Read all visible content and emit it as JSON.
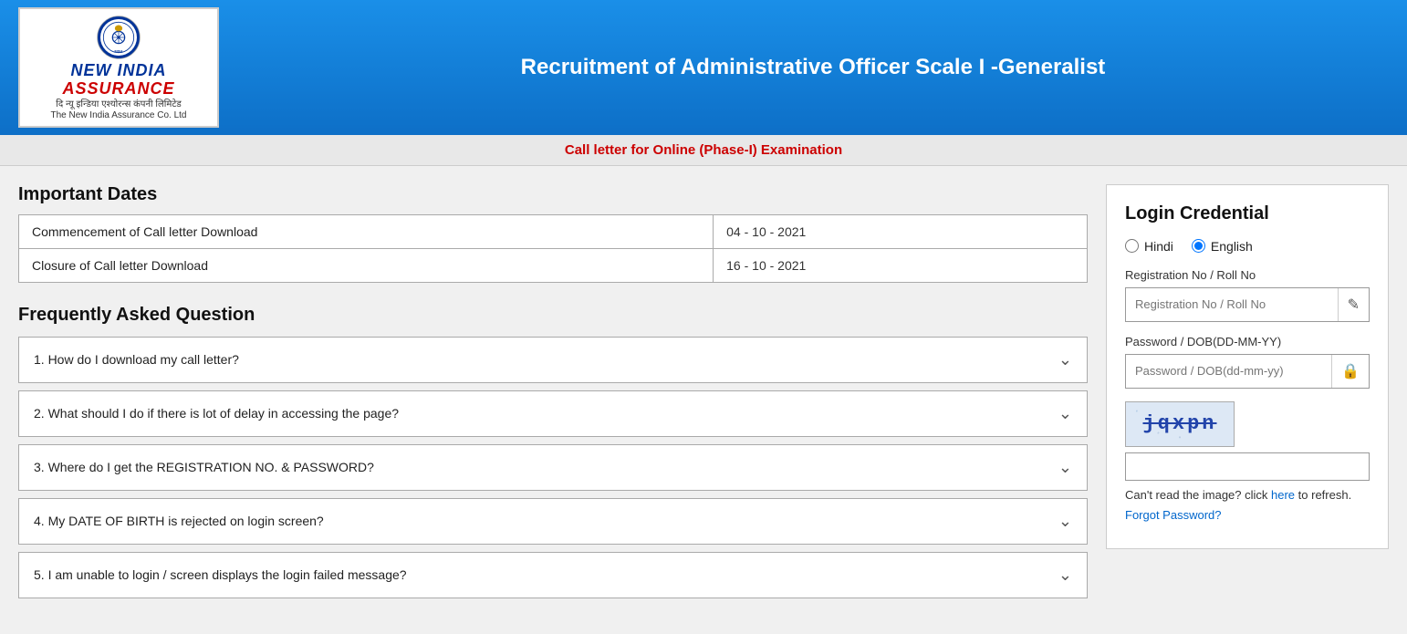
{
  "header": {
    "logo": {
      "title_line1": "NEW INDIA",
      "title_line2": "ASSURANCE",
      "hindi_line1": "दि न्यू इन्डिया एश्योरन्स कंपनी लिमिटेड",
      "english_line": "The New India Assurance Co. Ltd"
    },
    "title": "Recruitment of Administrative Officer Scale I -Generalist"
  },
  "sub_header": {
    "text": "Call letter for Online (Phase-I) Examination"
  },
  "important_dates": {
    "section_title": "Important Dates",
    "rows": [
      {
        "label": "Commencement of Call letter Download",
        "date": "04 - 10 - 2021"
      },
      {
        "label": "Closure of Call letter Download",
        "date": "16 - 10 - 2021"
      }
    ]
  },
  "faq": {
    "section_title": "Frequently Asked Question",
    "items": [
      {
        "id": 1,
        "text": "1. How do I download my call letter?"
      },
      {
        "id": 2,
        "text": "2. What should I do if there is lot of delay in accessing the page?"
      },
      {
        "id": 3,
        "text": "3. Where do I get the REGISTRATION NO. & PASSWORD?"
      },
      {
        "id": 4,
        "text": "4. My DATE OF BIRTH is rejected on login screen?"
      },
      {
        "id": 5,
        "text": "5. I am unable to login / screen displays the login failed message?"
      }
    ]
  },
  "login": {
    "title": "Login Credential",
    "languages": [
      {
        "value": "hindi",
        "label": "Hindi"
      },
      {
        "value": "english",
        "label": "English"
      }
    ],
    "selected_language": "english",
    "reg_no_label": "Registration No / Roll No",
    "reg_no_placeholder": "Registration No / Roll No",
    "password_label": "Password / DOB(DD-MM-YY)",
    "password_placeholder": "Password / DOB(dd-mm-yy)",
    "captcha_text": "jqxpn",
    "captcha_note_before": "Can't read the image? click ",
    "captcha_link_text": "here",
    "captcha_note_after": " to refresh.",
    "forgot_password": "Forgot Password?",
    "edit_icon": "✎",
    "lock_icon": "🔒"
  }
}
